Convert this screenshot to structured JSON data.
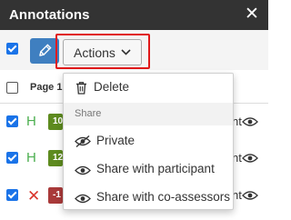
{
  "panel": {
    "title": "Annotations",
    "close_symbol": "✕"
  },
  "toolbar": {
    "select_all_checked": true,
    "edit_icon": "pencil-icon",
    "actions_label": "Actions",
    "accent_color": "#3f7fc0",
    "highlight_color": "#e0191a"
  },
  "table": {
    "header_checked": false,
    "page_column": "Page 1",
    "rows": [
      {
        "checked": true,
        "icon": "h-icon",
        "icon_text": "H",
        "tag": "10",
        "tag_color": "#5e8b1f",
        "trailing": "nt"
      },
      {
        "checked": true,
        "icon": "h-icon",
        "icon_text": "H",
        "tag": "12",
        "tag_color": "#5e8b1f",
        "trailing": "nt"
      },
      {
        "checked": true,
        "icon": "x-icon",
        "icon_text": "✕",
        "tag": "-1",
        "tag_color": "#a93a3a",
        "trailing": "nt"
      }
    ]
  },
  "actions_menu": {
    "delete_label": "Delete",
    "share_section_label": "Share",
    "private_label": "Private",
    "share_participant_label": "Share with participant",
    "share_coassessors_label": "Share with co-assessors"
  }
}
